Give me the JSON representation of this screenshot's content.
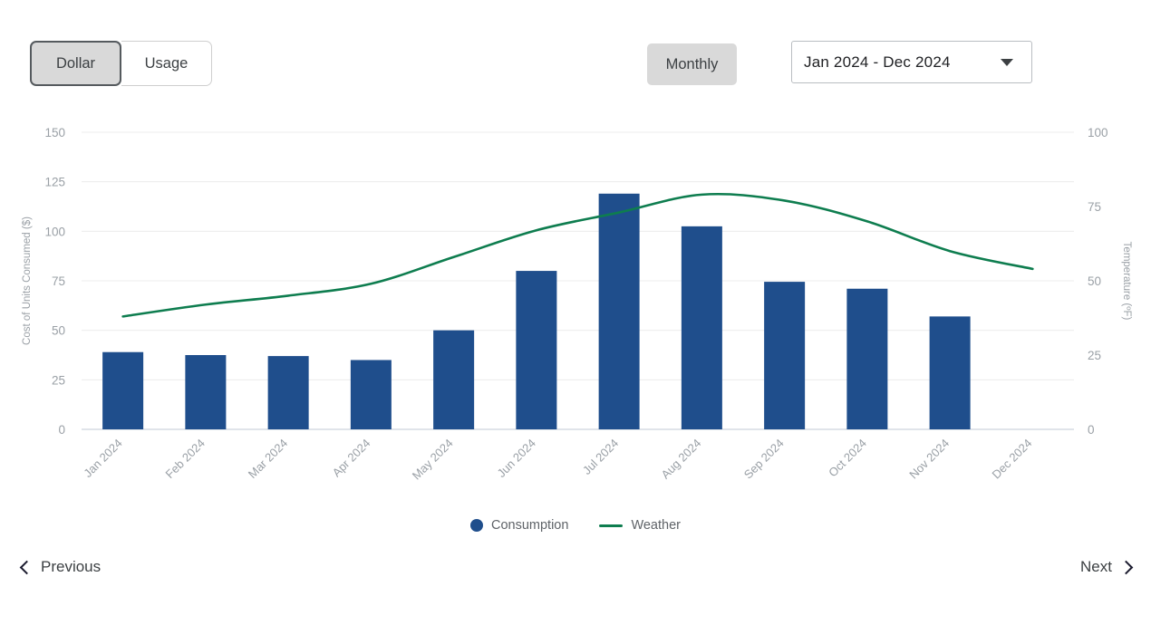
{
  "toolbar": {
    "unit_toggle": [
      {
        "label": "Dollar",
        "active": true
      },
      {
        "label": "Usage",
        "active": false
      }
    ],
    "period_label": "Monthly",
    "date_range_value": "Jan 2024 - Dec 2024",
    "caret_icon": "chevron-down-icon"
  },
  "legend": [
    {
      "label": "Consumption",
      "marker": "dot",
      "color": "#1f4e8c"
    },
    {
      "label": "Weather",
      "marker": "line",
      "color": "#0e7d4f"
    }
  ],
  "footer": {
    "previous_label": "Previous",
    "next_label": "Next",
    "previous_icon": "chevron-left-icon",
    "next_icon": "chevron-right-icon"
  },
  "chart_data": {
    "type": "bar",
    "title": "",
    "categories": [
      "Jan 2024",
      "Feb 2024",
      "Mar 2024",
      "Apr 2024",
      "May 2024",
      "Jun 2024",
      "Jul 2024",
      "Aug 2024",
      "Sep 2024",
      "Oct 2024",
      "Nov 2024",
      "Dec 2024"
    ],
    "xlabel": "",
    "ylabel": "Cost of Units Consumed ($)",
    "y2label": "Temperature (ºF)",
    "ylim": [
      0,
      150
    ],
    "y2lim": [
      0,
      100
    ],
    "yticks": [
      0,
      25,
      50,
      75,
      100,
      125,
      150
    ],
    "y2ticks": [
      0,
      25,
      50,
      75,
      100
    ],
    "grid": true,
    "legend_position": "bottom",
    "xtick_rotation": -45,
    "series": [
      {
        "name": "Consumption",
        "type": "bar",
        "axis": "left",
        "color": "#1f4e8c",
        "values": [
          39,
          37.5,
          37,
          35,
          50,
          80,
          119,
          102.5,
          74.5,
          71,
          57,
          null
        ]
      },
      {
        "name": "Weather",
        "type": "line",
        "axis": "right",
        "color": "#0e7d4f",
        "values": [
          38,
          42,
          45,
          49,
          58,
          67,
          73,
          79,
          77,
          70,
          60,
          54
        ]
      }
    ]
  }
}
